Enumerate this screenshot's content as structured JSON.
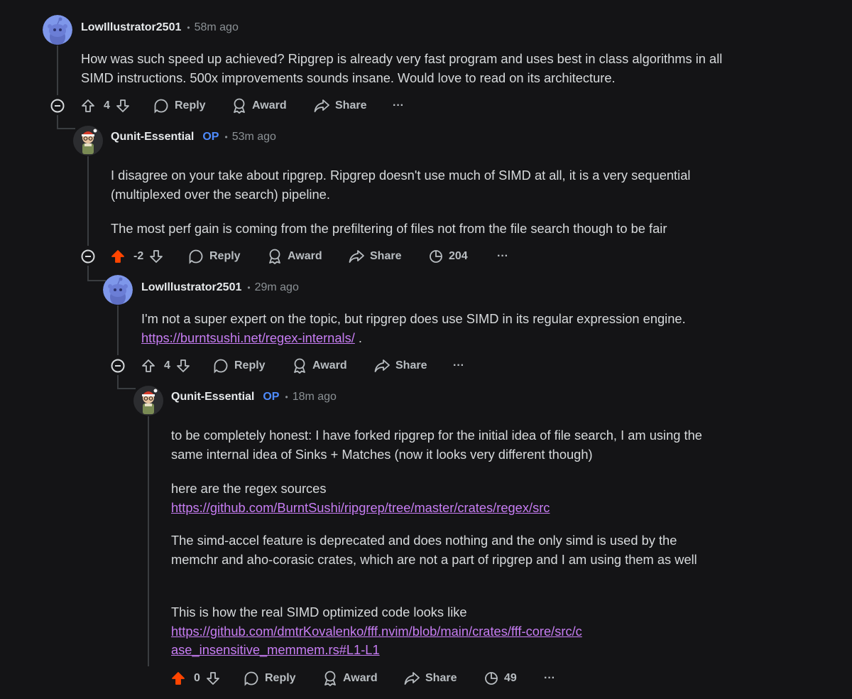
{
  "comments": [
    {
      "username": "LowIllustrator2501",
      "time": "58m ago",
      "paragraphs": [
        "How was such speed up achieved? Ripgrep is already very fast program and uses best in class algorithms in all SIMD instructions. 500x improvements sounds insane. Would love to read on its architecture."
      ],
      "score": "4",
      "reply": "Reply",
      "award": "Award",
      "share": "Share",
      "more": "···"
    },
    {
      "username": "Qunit-Essential",
      "op": "OP",
      "time": "53m ago",
      "paragraphs": [
        "I disagree on your take about ripgrep. Ripgrep doesn't use much of SIMD at all, it is a very sequential (multiplexed over the search) pipeline.",
        "The most perf gain is coming from the prefiltering of files not from the file search though to be fair"
      ],
      "score": "-2",
      "reply": "Reply",
      "award": "Award",
      "share": "Share",
      "views": "204",
      "more": "···"
    },
    {
      "username": "LowIllustrator2501",
      "time": "29m ago",
      "text": "I'm not a super expert on the topic, but ripgrep does use SIMD in its regular expression engine.",
      "link": "https://burntsushi.net/regex-internals/",
      "after_link": " .",
      "score": "4",
      "reply": "Reply",
      "award": "Award",
      "share": "Share",
      "more": "···"
    },
    {
      "username": "Qunit-Essential",
      "op": "OP",
      "time": "18m ago",
      "p1": "to be completely honest: I have forked ripgrep for the initial idea of file search, I am using the same internal idea of Sinks + Matches (now it looks very different though)",
      "p2_text": "here are the regex sources",
      "p2_link": "https://github.com/BurntSushi/ripgrep/tree/master/crates/regex/src",
      "p3": "The simd-accel feature is deprecated and does nothing and the only simd is used by the memchr and aho-corasic crates, which are not a part of ripgrep and I am using them as well",
      "p4_text": "This is how the real SIMD optimized code looks like",
      "p4_link": "https://github.com/dmtrKovalenko/fff.nvim/blob/main/crates/fff-core/src/case_insensitive_memmem.rs#L1-L1",
      "score": "0",
      "reply": "Reply",
      "award": "Award",
      "share": "Share",
      "views": "49",
      "more": "···"
    }
  ],
  "colors": {
    "upvoted": "#ff4500",
    "link": "#c77df3",
    "op": "#4f8cff",
    "background": "#141416"
  },
  "icons": [
    "snoo-avatar-icon",
    "character-avatar-icon",
    "upvote-icon",
    "downvote-icon",
    "reply-bubble-icon",
    "award-icon",
    "share-arrow-icon",
    "views-pie-icon",
    "more-icon",
    "collapse-minus-icon"
  ]
}
